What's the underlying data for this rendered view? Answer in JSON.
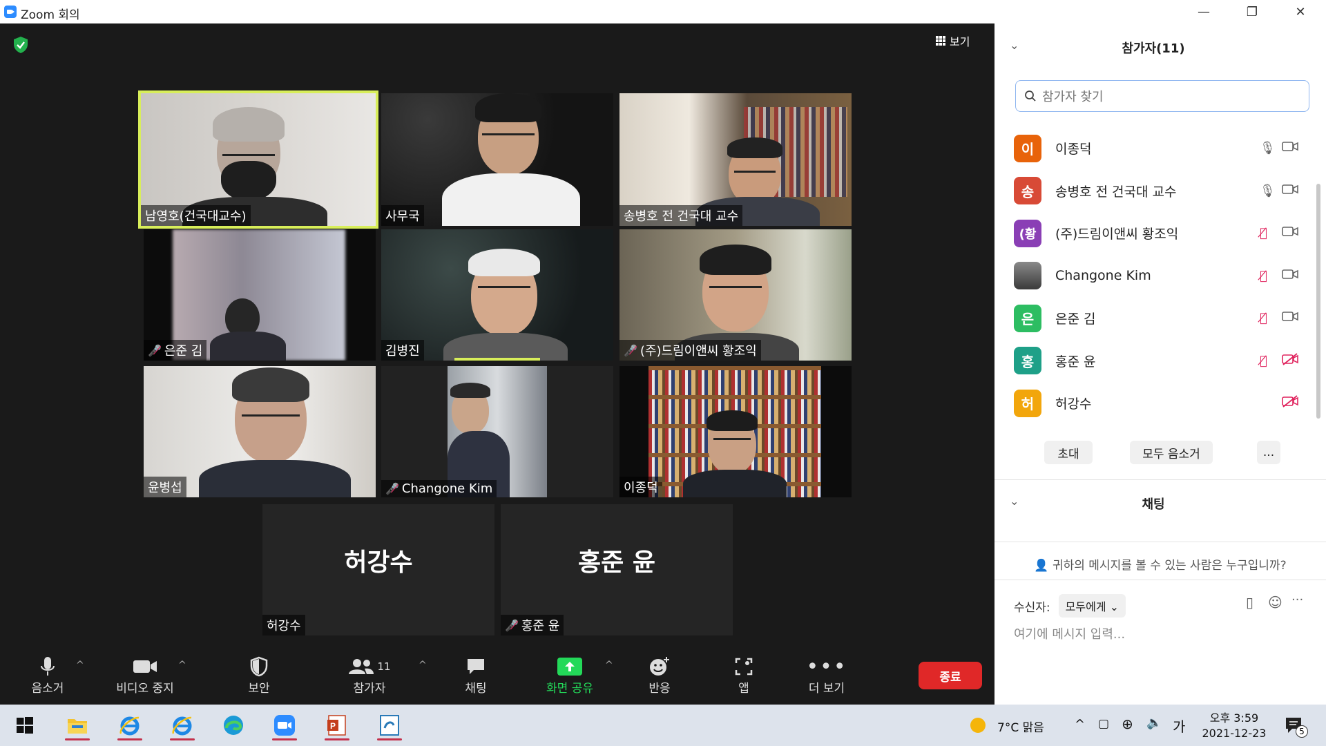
{
  "window": {
    "title": "Zoom 회의",
    "minimize": "—",
    "restore": "❐",
    "close": "✕"
  },
  "meeting": {
    "view_label": "보기",
    "tiles": [
      {
        "name": "남영호(건국대교수)",
        "muted": false,
        "active": true
      },
      {
        "name": "사무국",
        "muted": false
      },
      {
        "name": "송병호 전 건국대 교수",
        "muted": false
      },
      {
        "name": "은준 김",
        "muted": true
      },
      {
        "name": "김병진",
        "muted": false
      },
      {
        "name": "(주)드림이앤씨 황조익",
        "muted": true
      },
      {
        "name": "윤병섭",
        "muted": false
      },
      {
        "name": "Changone Kim",
        "muted": true
      },
      {
        "name": "이종덕",
        "muted": false
      }
    ],
    "avatar_tiles": [
      {
        "big_name": "허강수",
        "name": "허강수",
        "muted": false
      },
      {
        "big_name": "홍준 윤",
        "name": "홍준 윤",
        "muted": true
      }
    ]
  },
  "toolbar": {
    "mute": "음소거",
    "stop_video": "비디오 중지",
    "security": "보안",
    "participants": "참가자",
    "participants_count": "11",
    "chat": "채팅",
    "share_screen": "화면 공유",
    "reactions": "반응",
    "apps": "앱",
    "more": "더 보기",
    "end": "종료",
    "share_color": "#23d959"
  },
  "panel": {
    "participants_title": "참가자(11)",
    "search_placeholder": "참가자 찾기",
    "participants": [
      {
        "initial": "이",
        "name": "이종덕",
        "color": "#e8630a",
        "mic": "on",
        "video": "on"
      },
      {
        "initial": "송",
        "name": "송병호 전 건국대 교수",
        "color": "#d84a36",
        "mic": "on",
        "video": "on"
      },
      {
        "initial": "(황",
        "name": "(주)드림이앤씨 황조익",
        "color": "#8a3fb5",
        "mic": "off",
        "video": "on"
      },
      {
        "initial": "",
        "name": "Changone Kim",
        "color": "#555555",
        "mic": "off",
        "video": "on"
      },
      {
        "initial": "은",
        "name": "은준 김",
        "color": "#2dbd62",
        "mic": "off",
        "video": "on"
      },
      {
        "initial": "홍",
        "name": "홍준 윤",
        "color": "#1ea088",
        "mic": "off",
        "video": "off"
      },
      {
        "initial": "허",
        "name": "허강수",
        "color": "#f2a60c",
        "mic": "none",
        "video": "off"
      }
    ],
    "invite": "초대",
    "mute_all": "모두 음소거",
    "more": "...",
    "chat_title": "채팅",
    "who_can_see": "귀하의 메시지를 볼 수 있는 사람은 누구입니까?",
    "to_label": "수신자:",
    "to_value": "모두에게",
    "input_placeholder": "여기에 메시지 입력..."
  },
  "taskbar": {
    "weather": "7°C  맑음",
    "ime": "가",
    "time": "오후 3:59",
    "date": "2021-12-23",
    "notifications": "5"
  }
}
